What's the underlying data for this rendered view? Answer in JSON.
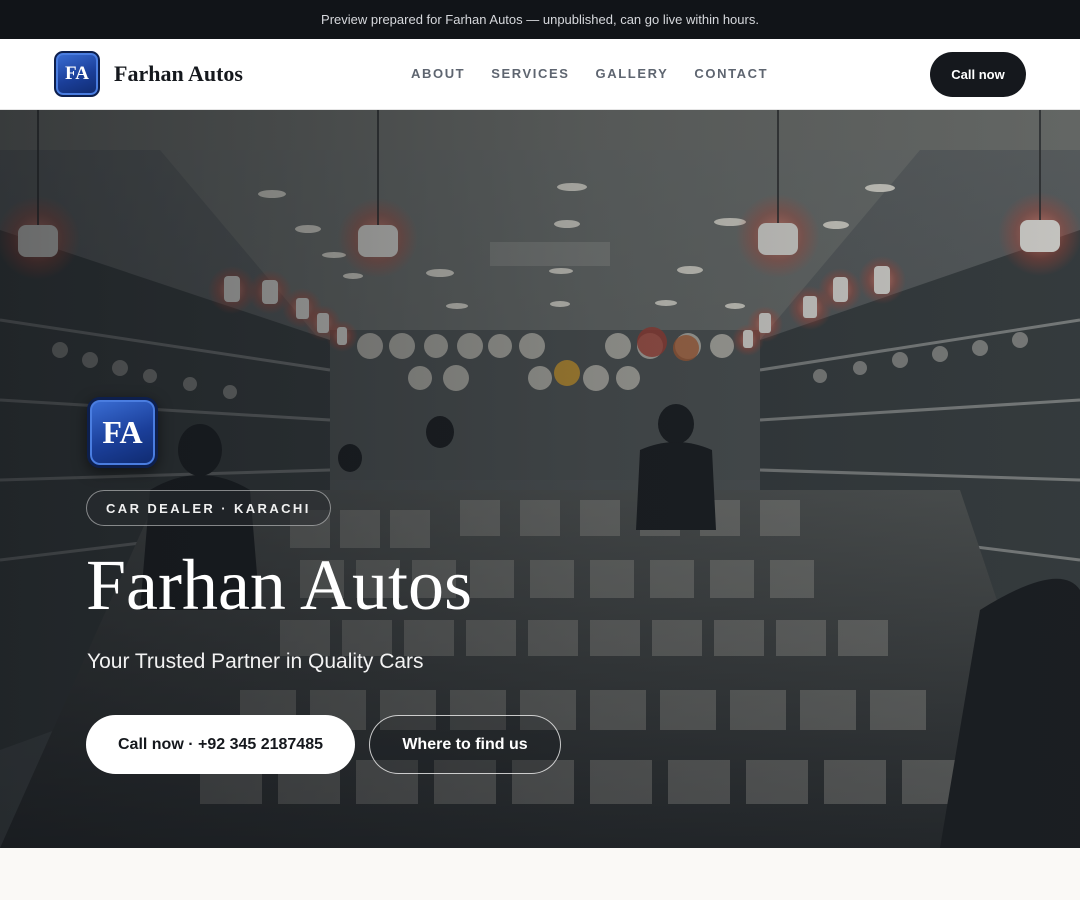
{
  "banner": {
    "text": "Preview prepared for Farhan Autos — unpublished, can go live within hours."
  },
  "header": {
    "logo_text": "FA",
    "brand_name": "Farhan Autos",
    "nav": [
      "ABOUT",
      "SERVICES",
      "GALLERY",
      "CONTACT"
    ],
    "cta_label": "Call now"
  },
  "hero": {
    "background": "photo of a brightly lit shop interior with shelves of dishware and display cases",
    "logo_text": "FA",
    "tag": "CAR DEALER · KARACHI",
    "title": "Farhan Autos",
    "subtitle": "Your Trusted Partner in Quality Cars",
    "primary_button": "Call now · +92 345 2187485",
    "secondary_button": "Where to find us"
  },
  "colors": {
    "topbar_bg": "#111418",
    "dark_button": "#15181d",
    "logo_blue": "#1b3f9a",
    "page_bg": "#faf9f6"
  }
}
